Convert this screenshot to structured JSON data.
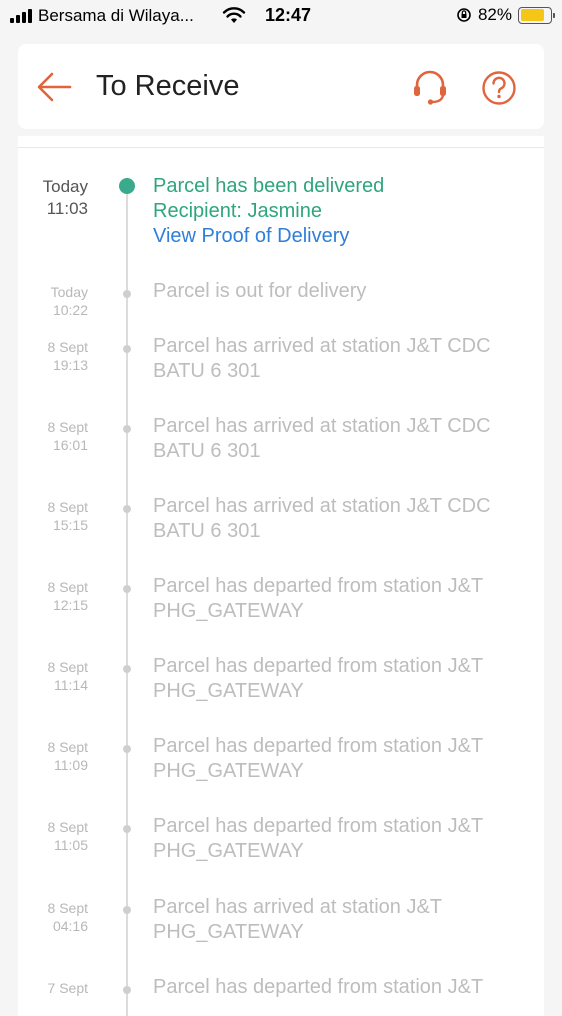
{
  "status_bar": {
    "carrier": "Bersama di Wilaya...",
    "time": "12:47",
    "battery_percent": "82%",
    "battery_level": 0.82,
    "battery_color": "#f5c518"
  },
  "header": {
    "title": "To Receive",
    "accent_color": "#e0643c",
    "icons": [
      "back-arrow-icon",
      "headset-icon",
      "help-circle-icon"
    ]
  },
  "timeline": {
    "current": {
      "date": "Today",
      "time": "11:03",
      "status": "Parcel has been delivered",
      "recipient": "Recipient: Jasmine",
      "link": "View Proof of Delivery",
      "color": "#2ea57f",
      "link_color": "#2f7fd8"
    },
    "events": [
      {
        "date": "Today",
        "time": "10:22",
        "text1": "Parcel is out for delivery",
        "text2": ""
      },
      {
        "date": "8 Sept",
        "time": "19:13",
        "text1": "Parcel has arrived at station J&T CDC",
        "text2": "BATU 6 301"
      },
      {
        "date": "8 Sept",
        "time": "16:01",
        "text1": "Parcel has arrived at station J&T CDC",
        "text2": "BATU 6 301"
      },
      {
        "date": "8 Sept",
        "time": "15:15",
        "text1": "Parcel has arrived at station J&T CDC",
        "text2": "BATU 6 301"
      },
      {
        "date": "8 Sept",
        "time": "12:15",
        "text1": "Parcel has departed from station J&T",
        "text2": "PHG_GATEWAY"
      },
      {
        "date": "8 Sept",
        "time": "11:14",
        "text1": "Parcel has departed from station J&T",
        "text2": "PHG_GATEWAY"
      },
      {
        "date": "8 Sept",
        "time": "11:09",
        "text1": "Parcel has departed from station J&T",
        "text2": "PHG_GATEWAY"
      },
      {
        "date": "8 Sept",
        "time": "11:05",
        "text1": "Parcel has departed from station J&T",
        "text2": "PHG_GATEWAY"
      },
      {
        "date": "8 Sept",
        "time": "04:16",
        "text1": "Parcel has arrived at station J&T",
        "text2": "PHG_GATEWAY"
      },
      {
        "date": "7 Sept",
        "time": "",
        "text1": "Parcel has departed from station J&T",
        "text2": ""
      }
    ]
  }
}
